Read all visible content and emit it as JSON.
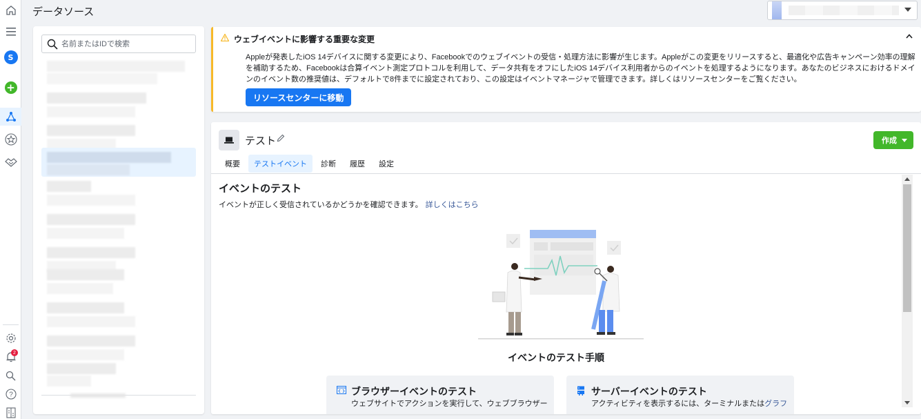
{
  "header": {
    "title": "データソース"
  },
  "rail": {
    "avatar_letter": "S",
    "notification_count": "2"
  },
  "list": {
    "search_placeholder": "名前またはIDで検索"
  },
  "alert": {
    "title": "ウェブイベントに影響する重要な変更",
    "body": "Appleが発表したiOS 14デバイスに関する変更により、Facebookでのウェブイベントの受信・処理方法に影響が生じます。Appleがこの変更をリリースすると、最適化や広告キャンペーン効率の理解を補助するため、Facebookは合算イベント測定プロトコルを利用して、データ共有をオフにしたiOS 14デバイス利用者からのイベントを処理するようになります。あなたのビジネスにおけるドメインのイベント数の推奨値は、デフォルトで8件までに設定されており、この設定はイベントマネージャで管理できます。詳しくはリソースセンターをご覧ください。",
    "button_label": "リソースセンターに移動"
  },
  "detail": {
    "source_name": "テスト",
    "create_label": "作成",
    "tabs": [
      {
        "label": "概要"
      },
      {
        "label": "テストイベント"
      },
      {
        "label": "診断"
      },
      {
        "label": "履歴"
      },
      {
        "label": "設定"
      }
    ],
    "active_tab": "テストイベント",
    "content_title": "イベントのテスト",
    "content_desc": "イベントが正しく受信されているかどうかを確認できます。",
    "learn_more": "詳しくはこちら",
    "steps_title": "イベントのテスト手順",
    "cards": [
      {
        "title": "ブラウザーイベントのテスト",
        "desc": "ウェブサイトでアクションを実行して、ウェブブラウザー"
      },
      {
        "title": "サーバーイベントのテスト",
        "desc": "アクティビティを表示するには、ターミナルまたは",
        "link": "グラフ"
      }
    ]
  },
  "colors": {
    "accent": "#1877f2",
    "success": "#42b72a",
    "warning": "#f7b928",
    "link": "#385898"
  }
}
